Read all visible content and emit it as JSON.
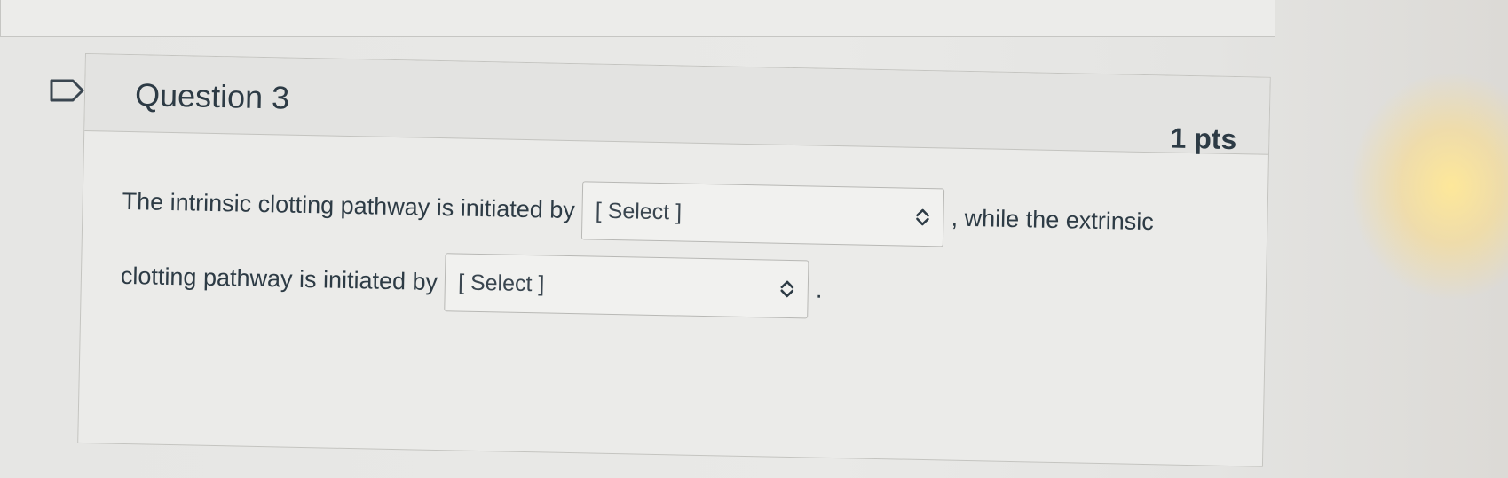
{
  "question": {
    "title": "Question 3",
    "points": "1 pts",
    "text_before_select_1": "The intrinsic clotting pathway is initiated by",
    "text_after_select_1": ", while the extrinsic",
    "text_before_select_2": "clotting pathway is initiated by",
    "text_after_select_2": ".",
    "selects": [
      {
        "value": "[ Select ]"
      },
      {
        "value": "[ Select ]"
      }
    ]
  },
  "icons": {
    "flag": "flag-question-icon",
    "select_chevron": "chevron-up-down-icon"
  }
}
